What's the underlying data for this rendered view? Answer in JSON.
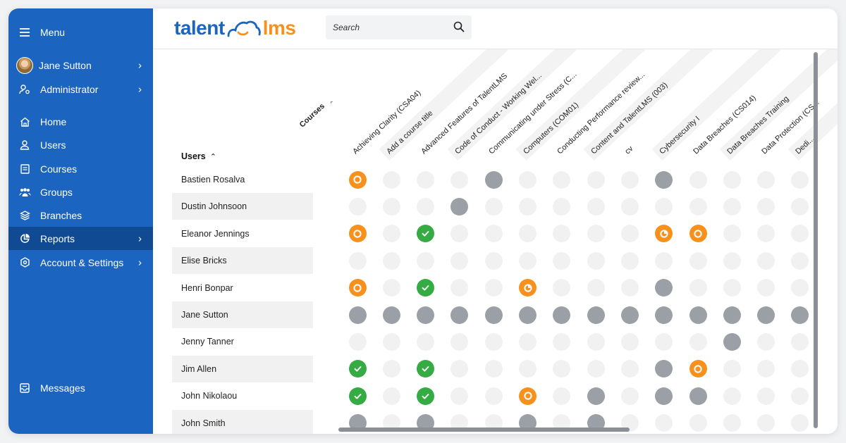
{
  "sidebar": {
    "menu_label": "Menu",
    "user_name": "Jane Sutton",
    "role": "Administrator",
    "items": [
      {
        "label": "Home"
      },
      {
        "label": "Users"
      },
      {
        "label": "Courses"
      },
      {
        "label": "Groups"
      },
      {
        "label": "Branches"
      },
      {
        "label": "Reports"
      },
      {
        "label": "Account & Settings"
      }
    ],
    "messages_label": "Messages"
  },
  "header": {
    "logo_part1": "talent",
    "logo_part2": "lms",
    "search_placeholder": "Search"
  },
  "grid": {
    "users_label": "Users",
    "courses_label": "Courses",
    "columns": [
      "Achieving Clarity (CSA04)",
      "Add a course title",
      "Advanced Features of TalentLMS",
      "Code of Conduct - Working Wel...",
      "Communicating under Stress (C...",
      "Computers (COM01)",
      "Conducting Performance review...",
      "Content and TalentLMS (003)",
      "cv",
      "Cybersecurity I",
      "Data Breaches (CS014)",
      "Data Breaches Training",
      "Data Protection (CS...",
      "Dedi..."
    ],
    "rows": [
      {
        "name": "Bastien Rosalva",
        "cells": [
          "prog",
          "e",
          "e",
          "e",
          "gray",
          "e",
          "e",
          "e",
          "e",
          "gray",
          "e",
          "e",
          "e",
          "e"
        ]
      },
      {
        "name": "Dustin Johnsoon",
        "cells": [
          "e",
          "e",
          "e",
          "gray",
          "e",
          "e",
          "e",
          "e",
          "e",
          "e",
          "e",
          "e",
          "e",
          "e"
        ]
      },
      {
        "name": "Eleanor Jennings",
        "cells": [
          "prog",
          "e",
          "done",
          "e",
          "e",
          "e",
          "e",
          "e",
          "e",
          "part",
          "prog",
          "e",
          "e",
          "e"
        ]
      },
      {
        "name": "Elise Bricks",
        "cells": [
          "e",
          "e",
          "e",
          "e",
          "e",
          "e",
          "e",
          "e",
          "e",
          "e",
          "e",
          "e",
          "e",
          "e"
        ]
      },
      {
        "name": "Henri Bonpar",
        "cells": [
          "prog",
          "e",
          "done",
          "e",
          "e",
          "part",
          "e",
          "e",
          "e",
          "gray",
          "e",
          "e",
          "e",
          "e"
        ]
      },
      {
        "name": "Jane Sutton",
        "cells": [
          "gray",
          "gray",
          "gray",
          "gray",
          "gray",
          "gray",
          "gray",
          "gray",
          "gray",
          "gray",
          "gray",
          "gray",
          "gray",
          "gray"
        ]
      },
      {
        "name": "Jenny Tanner",
        "cells": [
          "e",
          "e",
          "e",
          "e",
          "e",
          "e",
          "e",
          "e",
          "e",
          "e",
          "e",
          "gray",
          "e",
          "e"
        ]
      },
      {
        "name": "Jim Allen",
        "cells": [
          "done",
          "e",
          "done",
          "e",
          "e",
          "e",
          "e",
          "e",
          "e",
          "gray",
          "prog",
          "e",
          "e",
          "e"
        ]
      },
      {
        "name": "John Nikolaou",
        "cells": [
          "done",
          "e",
          "done",
          "e",
          "e",
          "prog",
          "e",
          "gray",
          "e",
          "gray",
          "gray",
          "e",
          "e",
          "e"
        ]
      },
      {
        "name": "John Smith",
        "cells": [
          "gray",
          "e",
          "gray",
          "e",
          "e",
          "gray",
          "e",
          "gray",
          "e",
          "e",
          "e",
          "e",
          "e",
          "e"
        ]
      }
    ]
  },
  "colors": {
    "sidebar": "#1b65c0",
    "sidebar_active": "#0f4a93",
    "completed": "#34ac43",
    "in_progress": "#f6911e",
    "not_enrolled": "#f1f1f1",
    "enrolled": "#9aa0a6"
  }
}
